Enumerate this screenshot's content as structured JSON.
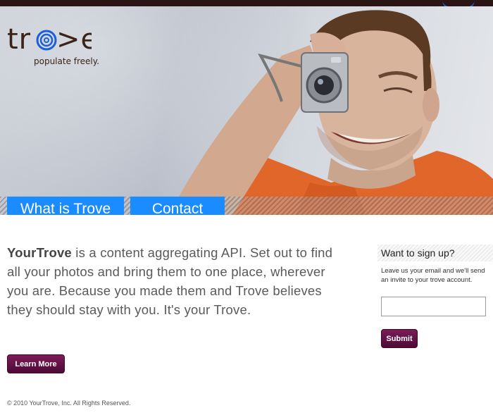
{
  "brand": {
    "logo_text": "tr⧖>e",
    "tagline": "populate freely."
  },
  "nav": {
    "items": [
      {
        "label": "What is Trove"
      },
      {
        "label": "Contact"
      }
    ]
  },
  "intro": {
    "lead": "YourTrove",
    "body": " is a content aggregating API. Set out to find all your photos and bring them to one place, wherever you are. Because you made them and Trove believes they should stay with you. It's your Trove."
  },
  "learn_more_label": "Learn More",
  "signup": {
    "title": "Want to sign up?",
    "description": "Leave us your email and we'll send an invite to your trove account.",
    "email_value": "",
    "submit_label": "Submit"
  },
  "footer": {
    "copyright": "© 2010 YourTrove, Inc. All Rights Reserved."
  },
  "colors": {
    "nav_blue": "#1a8cff",
    "button_plum": "#6a1249",
    "shirt_orange": "#e0662a",
    "topbar": "#2b1414"
  },
  "icons": {
    "logo_spiral": "spiral-icon"
  }
}
